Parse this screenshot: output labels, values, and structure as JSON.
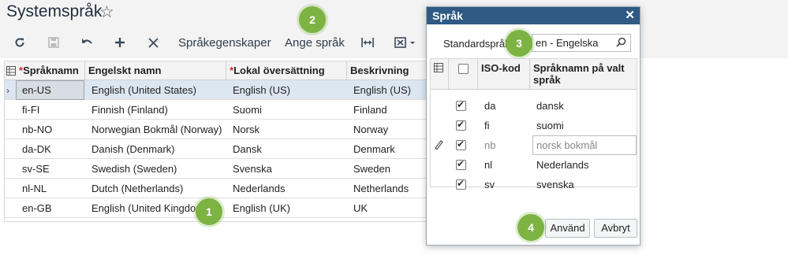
{
  "page": {
    "title": "Systemspråk"
  },
  "toolbar": {
    "properties_label": "Språkegenskaper",
    "set_language_label": "Ange språk"
  },
  "grid": {
    "columns": [
      "Språknamn",
      "Engelskt namn",
      "Lokal översättning",
      "Beskrivning"
    ],
    "rows": [
      {
        "name": "en-US",
        "english": "English (United States)",
        "local": "English (US)",
        "desc": "English (US)"
      },
      {
        "name": "fi-FI",
        "english": "Finnish (Finland)",
        "local": "Suomi",
        "desc": "Finland"
      },
      {
        "name": "nb-NO",
        "english": "Norwegian Bokmål (Norway)",
        "local": "Norsk",
        "desc": "Norway"
      },
      {
        "name": "da-DK",
        "english": "Danish (Denmark)",
        "local": "Dansk",
        "desc": "Denmark"
      },
      {
        "name": "sv-SE",
        "english": "Swedish (Sweden)",
        "local": "Svenska",
        "desc": "Sweden"
      },
      {
        "name": "nl-NL",
        "english": "Dutch (Netherlands)",
        "local": "Nederlands",
        "desc": "Netherlands"
      },
      {
        "name": "en-GB",
        "english": "English (United Kingdom)",
        "local": "English (UK)",
        "desc": "UK"
      }
    ]
  },
  "dialog": {
    "title": "Språk",
    "std_label": "Standardspråk:",
    "std_value": "en - Engelska",
    "col_iso": "ISO-kod",
    "col_name_line1": "Språknamn på valt",
    "col_name_line2": "språk",
    "rows": [
      {
        "iso": "da",
        "name": "dansk",
        "checked": true
      },
      {
        "iso": "fi",
        "name": "suomi",
        "checked": true
      },
      {
        "iso": "nb",
        "name": "norsk bokmål",
        "checked": true
      },
      {
        "iso": "nl",
        "name": "Nederlands",
        "checked": true
      },
      {
        "iso": "sv",
        "name": "svenska",
        "checked": true
      }
    ],
    "apply_label": "Använd",
    "cancel_label": "Avbryt"
  },
  "callouts": [
    "1",
    "2",
    "3",
    "4"
  ],
  "colors": {
    "dialog_header": "#2e5a83",
    "callout": "#7cb342",
    "required": "#d0312d"
  }
}
